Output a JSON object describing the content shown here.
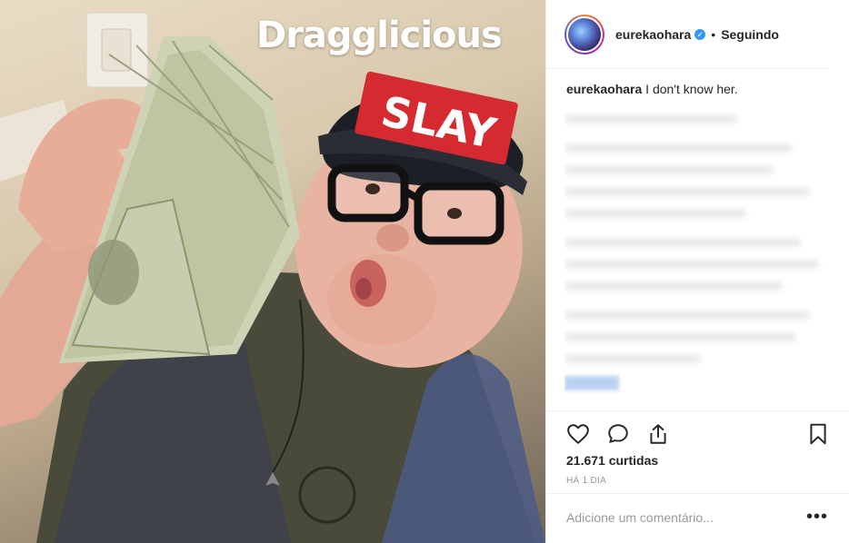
{
  "media": {
    "watermark": "Dragglicious",
    "cap_text": "SLAY"
  },
  "header": {
    "username": "eurekaohara",
    "verified_icon": "verified-badge-icon",
    "separator": "•",
    "follow_status": "Seguindo"
  },
  "caption": {
    "username": "eurekaohara",
    "text": "I don't know her."
  },
  "actions": {
    "like_icon": "heart-icon",
    "comment_icon": "comment-icon",
    "share_icon": "share-icon",
    "save_icon": "bookmark-icon"
  },
  "likes_text": "21.671 curtidas",
  "timestamp": "HÁ 1 DIA",
  "comment_box": {
    "placeholder": "Adicione um comentário...",
    "more": "•••"
  },
  "colors": {
    "accent": "#3897f0",
    "text": "#262626",
    "muted": "#999999",
    "cap_red": "#d42a30"
  }
}
